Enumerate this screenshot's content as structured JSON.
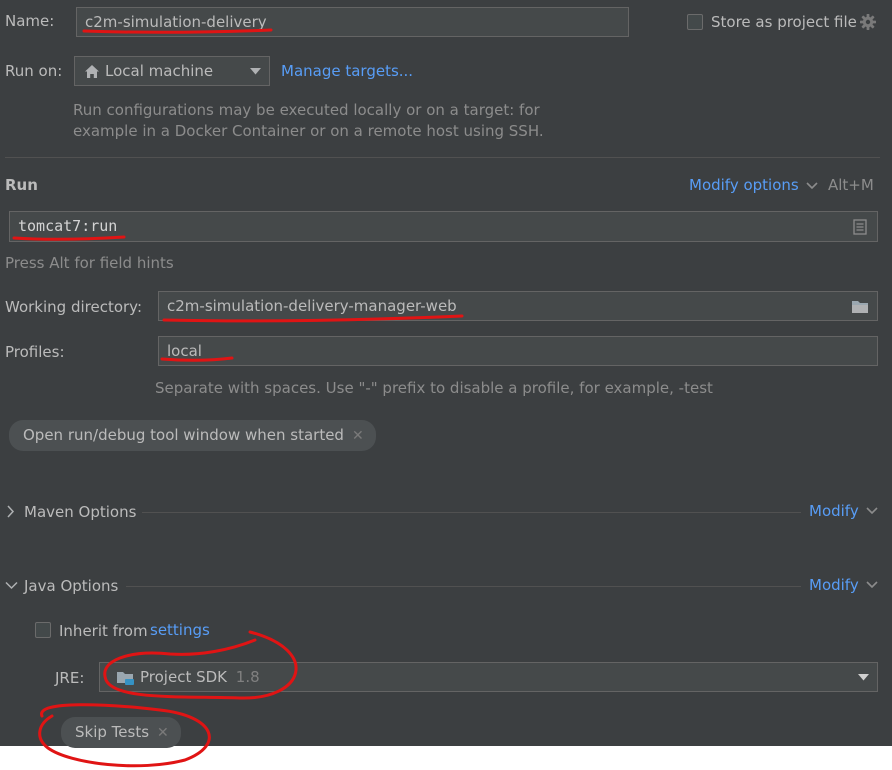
{
  "header": {
    "name_label": "Name:",
    "name_value": "c2m-simulation-delivery",
    "store_label": "Store as project file",
    "store_checked": false
  },
  "run_on": {
    "label": "Run on:",
    "target": "Local machine",
    "manage_link": "Manage targets...",
    "description_line1": "Run configurations may be executed locally or on a target: for",
    "description_line2": "example in a Docker Container or on a remote host using SSH."
  },
  "run_section": {
    "title": "Run",
    "modify_options": "Modify options",
    "shortcut": "Alt+M",
    "command": "tomcat7:run",
    "field_hint": "Press Alt for field hints",
    "working_dir_label": "Working directory:",
    "working_dir_value": "c2m-simulation-delivery-manager-web",
    "profiles_label": "Profiles:",
    "profiles_value": "local",
    "profiles_hint": "Separate with spaces. Use \"-\" prefix to disable a profile, for example, -test",
    "open_tool_window_chip": "Open run/debug tool window when started"
  },
  "maven_options": {
    "title": "Maven Options",
    "modify": "Modify",
    "expanded": false
  },
  "java_options": {
    "title": "Java Options",
    "modify": "Modify",
    "expanded": true,
    "inherit_label": "Inherit from",
    "inherit_link": "settings",
    "inherit_checked": false,
    "jre_label": "JRE:",
    "jre_value": "Project SDK",
    "jre_version": "1.8",
    "skip_tests_chip": "Skip Tests"
  },
  "icons": {
    "home": "home-icon",
    "dropdown": "chevron-down-icon",
    "gear": "gear-icon",
    "expand": "expand-icon",
    "folder": "folder-icon",
    "chevron_right": "chevron-right-icon",
    "close": "close-icon"
  },
  "colors": {
    "panel_bg": "#3c3f41",
    "field_bg": "#45494a",
    "link": "#589df6",
    "annotation_red": "#e01414"
  }
}
